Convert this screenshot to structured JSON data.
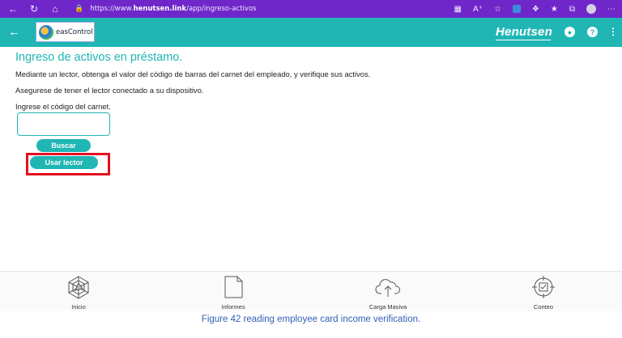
{
  "browser": {
    "url_prefix": "https://www.",
    "url_domain": "henutsen.link",
    "url_path": "/app/ingreso-activos"
  },
  "header": {
    "logo_text": "easControl",
    "brand": "Henutsen"
  },
  "main": {
    "title": "Ingreso de activos en préstamo.",
    "line1": "Mediante un lector, obtenga el valor del código de barras del carnet del empleado, y verifique sus activos.",
    "line2": "Asegurese de tener el lector conectado a su dispositivo.",
    "line3": "Ingrese el código del carnet.",
    "code_value": "",
    "search_label": "Buscar",
    "reader_label": "Usar lector"
  },
  "bottom_nav": [
    {
      "label": "Inicio",
      "icon": "radar-icon"
    },
    {
      "label": "Informes",
      "icon": "document-icon"
    },
    {
      "label": "Carga Masiva",
      "icon": "cloud-upload-icon"
    },
    {
      "label": "Conteo",
      "icon": "target-check-icon"
    }
  ],
  "caption": "Figure 42 reading employee card income verification.",
  "colors": {
    "browser_bar": "#6f27c9",
    "accent": "#1fb6b4",
    "highlight": "#e3101f",
    "caption": "#2e5fb5"
  }
}
